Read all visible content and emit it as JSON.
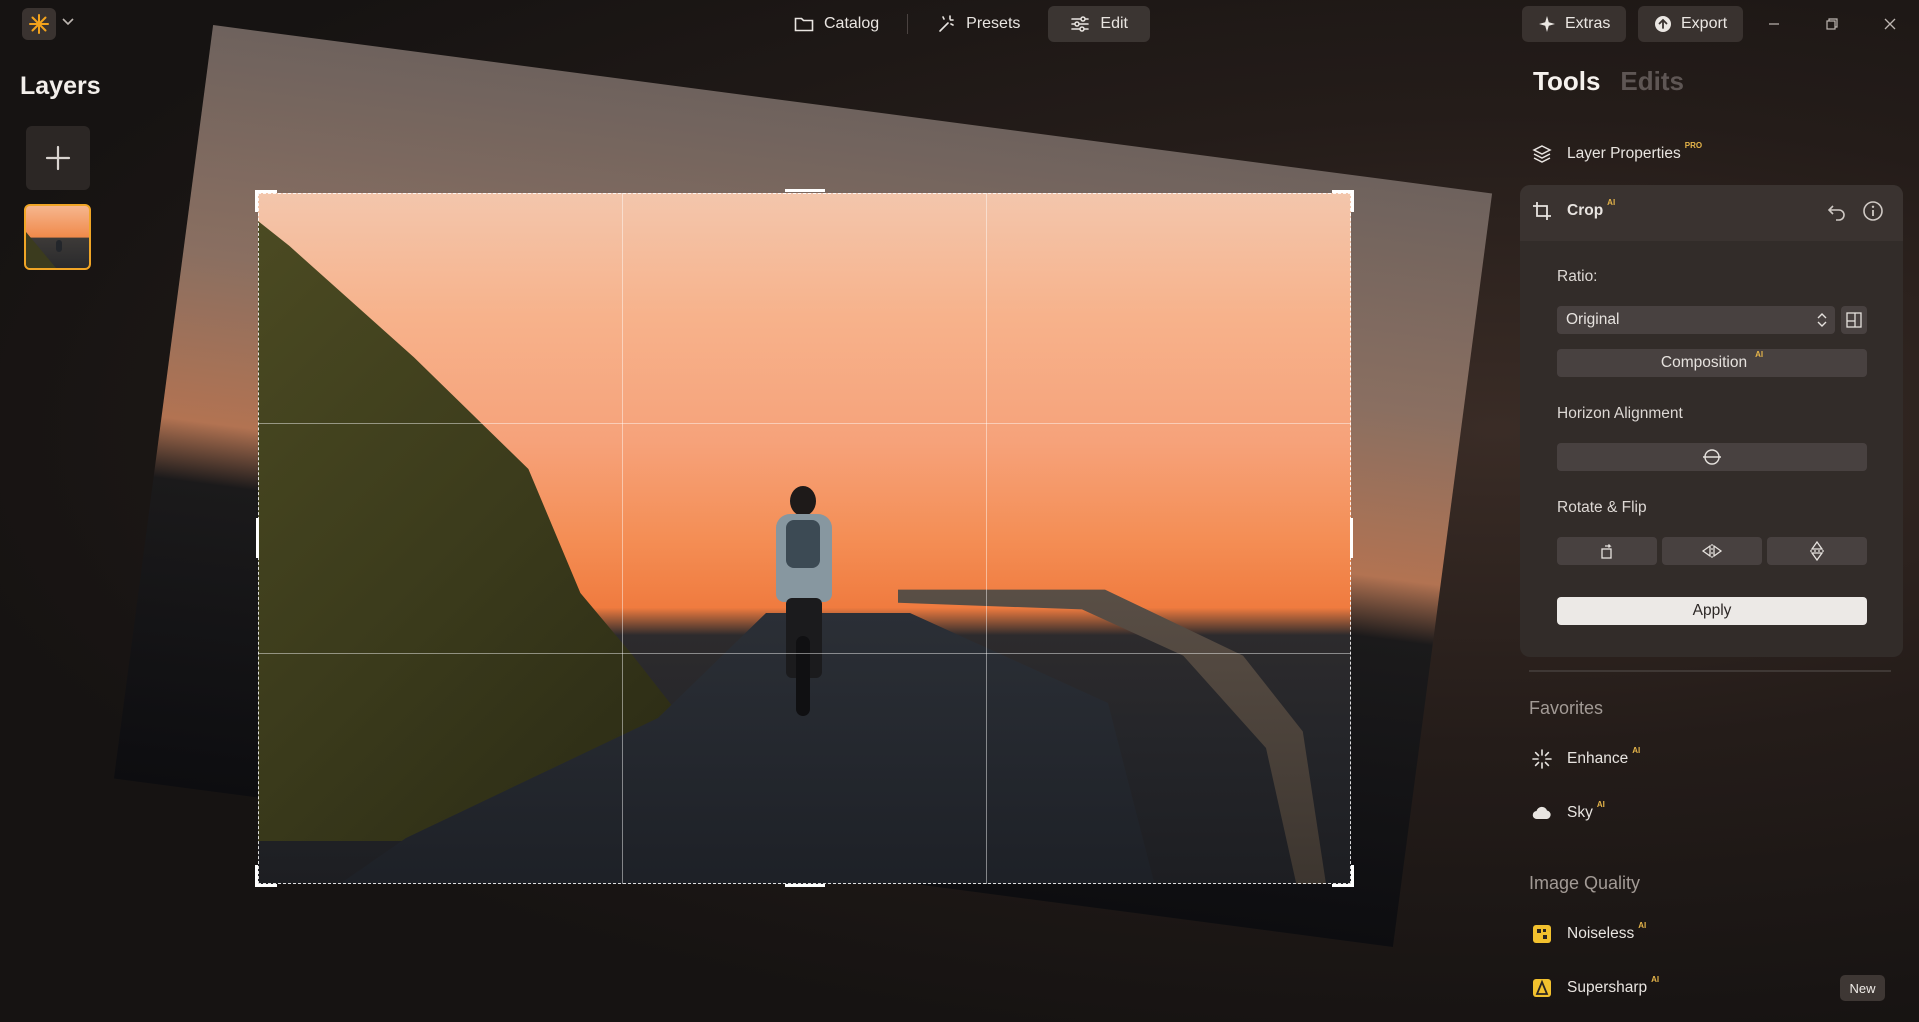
{
  "topbar": {
    "modes": [
      {
        "label": "Catalog",
        "icon": "folder-icon"
      },
      {
        "label": "Presets",
        "icon": "magic-wand-icon"
      },
      {
        "label": "Edit",
        "icon": "sliders-icon",
        "active": true
      }
    ],
    "extras_label": "Extras",
    "export_label": "Export"
  },
  "layers": {
    "title": "Layers"
  },
  "tools_panel": {
    "tabs": [
      "Tools",
      "Edits"
    ],
    "layer_properties": {
      "label": "Layer Properties",
      "badge": "PRO"
    },
    "crop": {
      "label": "Crop",
      "badge": "AI",
      "ratio_label": "Ratio:",
      "ratio_value": "Original",
      "composition_label": "Composition",
      "composition_badge": "AI",
      "horizon_label": "Horizon Alignment",
      "rotate_label": "Rotate & Flip",
      "apply_label": "Apply"
    },
    "favorites": {
      "title": "Favorites",
      "items": [
        {
          "label": "Enhance",
          "badge": "AI"
        },
        {
          "label": "Sky",
          "badge": "AI"
        }
      ]
    },
    "image_quality": {
      "title": "Image Quality",
      "items": [
        {
          "label": "Noiseless",
          "badge": "AI"
        },
        {
          "label": "Supersharp",
          "badge": "AI",
          "tag": "New"
        }
      ]
    }
  },
  "colors": {
    "accent": "#f0a526",
    "badge": "#e6b54a",
    "panel": "#322c29"
  }
}
